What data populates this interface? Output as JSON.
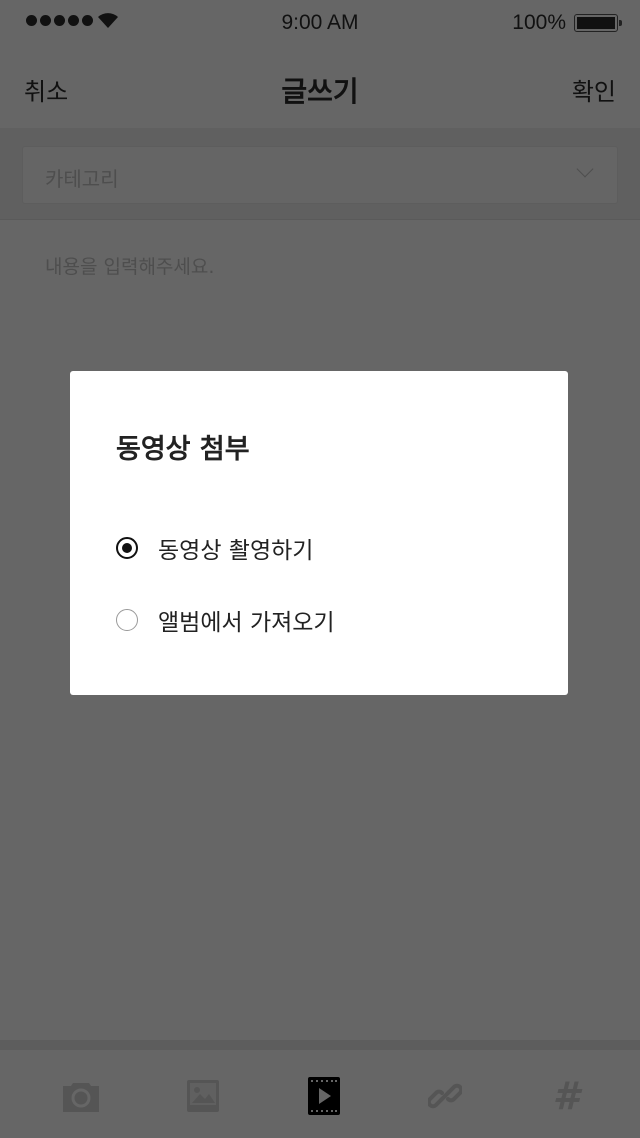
{
  "status_bar": {
    "time": "9:00 AM",
    "battery": "100%"
  },
  "nav": {
    "cancel": "취소",
    "title": "글쓰기",
    "confirm": "확인"
  },
  "category": {
    "placeholder": "카테고리"
  },
  "content": {
    "placeholder": "내용을 입력해주세요."
  },
  "toolbar": {
    "items": [
      "camera-icon",
      "image-icon",
      "video-icon",
      "link-icon",
      "hashtag-icon"
    ],
    "active": "video-icon"
  },
  "dialog": {
    "title": "동영상 첨부",
    "options": [
      {
        "label": "동영상 촬영하기",
        "selected": true
      },
      {
        "label": "앨범에서 가져오기",
        "selected": false
      }
    ]
  }
}
